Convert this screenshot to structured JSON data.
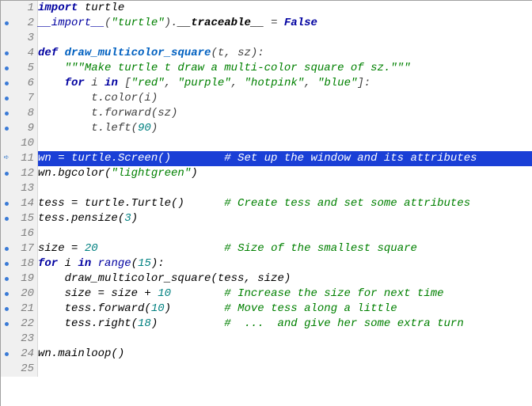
{
  "editor": {
    "current_line": 11,
    "lines": [
      {
        "n": 1,
        "marker": "",
        "tokens": [
          {
            "t": "kw",
            "v": "import"
          },
          {
            "t": "op",
            "v": " "
          },
          {
            "t": "attr",
            "v": "turtle"
          }
        ]
      },
      {
        "n": 2,
        "marker": "bp",
        "tokens": [
          {
            "t": "builtin",
            "v": "__import__"
          },
          {
            "t": "op",
            "v": "("
          },
          {
            "t": "str",
            "v": "\"turtle\""
          },
          {
            "t": "op",
            "v": ")."
          },
          {
            "t": "strongattr",
            "v": "__traceable__"
          },
          {
            "t": "op",
            "v": " = "
          },
          {
            "t": "bool",
            "v": "False"
          }
        ]
      },
      {
        "n": 3,
        "marker": "",
        "tokens": []
      },
      {
        "n": 4,
        "marker": "bp",
        "tokens": [
          {
            "t": "kw",
            "v": "def"
          },
          {
            "t": "op",
            "v": " "
          },
          {
            "t": "fn",
            "v": "draw_multicolor_square"
          },
          {
            "t": "op",
            "v": "(t, sz):"
          }
        ]
      },
      {
        "n": 5,
        "marker": "bp",
        "tokens": [
          {
            "t": "op",
            "v": "    "
          },
          {
            "t": "str",
            "v": "\"\"\"Make turtle t draw a multi-color square of sz.\"\"\""
          }
        ]
      },
      {
        "n": 6,
        "marker": "bp",
        "tokens": [
          {
            "t": "op",
            "v": "    "
          },
          {
            "t": "kw",
            "v": "for"
          },
          {
            "t": "op",
            "v": " i "
          },
          {
            "t": "kw",
            "v": "in"
          },
          {
            "t": "op",
            "v": " ["
          },
          {
            "t": "str",
            "v": "\"red\""
          },
          {
            "t": "op",
            "v": ", "
          },
          {
            "t": "str",
            "v": "\"purple\""
          },
          {
            "t": "op",
            "v": ", "
          },
          {
            "t": "str",
            "v": "\"hotpink\""
          },
          {
            "t": "op",
            "v": ", "
          },
          {
            "t": "str",
            "v": "\"blue\""
          },
          {
            "t": "op",
            "v": "]:"
          }
        ]
      },
      {
        "n": 7,
        "marker": "bp",
        "tokens": [
          {
            "t": "op",
            "v": "        t.color(i)"
          }
        ]
      },
      {
        "n": 8,
        "marker": "bp",
        "tokens": [
          {
            "t": "op",
            "v": "        t.forward(sz)"
          }
        ]
      },
      {
        "n": 9,
        "marker": "bp",
        "tokens": [
          {
            "t": "op",
            "v": "        t.left("
          },
          {
            "t": "num",
            "v": "90"
          },
          {
            "t": "op",
            "v": ")"
          }
        ]
      },
      {
        "n": 10,
        "marker": "",
        "tokens": []
      },
      {
        "n": 11,
        "marker": "arrow",
        "tokens": [
          {
            "t": "attr",
            "v": "wn = turtle.Screen()        "
          },
          {
            "t": "cmt",
            "v": "# Set up the window and its attributes"
          }
        ]
      },
      {
        "n": 12,
        "marker": "bp",
        "tokens": [
          {
            "t": "attr",
            "v": "wn.bgcolor("
          },
          {
            "t": "str",
            "v": "\"lightgreen\""
          },
          {
            "t": "attr",
            "v": ")"
          }
        ]
      },
      {
        "n": 13,
        "marker": "",
        "tokens": []
      },
      {
        "n": 14,
        "marker": "bp",
        "tokens": [
          {
            "t": "attr",
            "v": "tess = turtle.Turtle()      "
          },
          {
            "t": "cmt",
            "v": "# Create tess and set some attributes"
          }
        ]
      },
      {
        "n": 15,
        "marker": "bp",
        "tokens": [
          {
            "t": "attr",
            "v": "tess.pensize("
          },
          {
            "t": "num",
            "v": "3"
          },
          {
            "t": "attr",
            "v": ")"
          }
        ]
      },
      {
        "n": 16,
        "marker": "",
        "tokens": []
      },
      {
        "n": 17,
        "marker": "bp",
        "tokens": [
          {
            "t": "attr",
            "v": "size = "
          },
          {
            "t": "num",
            "v": "20"
          },
          {
            "t": "attr",
            "v": "                   "
          },
          {
            "t": "cmt",
            "v": "# Size of the smallest square"
          }
        ]
      },
      {
        "n": 18,
        "marker": "bp",
        "tokens": [
          {
            "t": "kw",
            "v": "for"
          },
          {
            "t": "attr",
            "v": " i "
          },
          {
            "t": "kw",
            "v": "in"
          },
          {
            "t": "attr",
            "v": " "
          },
          {
            "t": "builtin",
            "v": "range"
          },
          {
            "t": "attr",
            "v": "("
          },
          {
            "t": "num",
            "v": "15"
          },
          {
            "t": "attr",
            "v": "):"
          }
        ]
      },
      {
        "n": 19,
        "marker": "bp",
        "tokens": [
          {
            "t": "attr",
            "v": "    draw_multicolor_square(tess, size)"
          }
        ]
      },
      {
        "n": 20,
        "marker": "bp",
        "tokens": [
          {
            "t": "attr",
            "v": "    size = size + "
          },
          {
            "t": "num",
            "v": "10"
          },
          {
            "t": "attr",
            "v": "        "
          },
          {
            "t": "cmt",
            "v": "# Increase the size for next time"
          }
        ]
      },
      {
        "n": 21,
        "marker": "bp",
        "tokens": [
          {
            "t": "attr",
            "v": "    tess.forward("
          },
          {
            "t": "num",
            "v": "10"
          },
          {
            "t": "attr",
            "v": ")        "
          },
          {
            "t": "cmt",
            "v": "# Move tess along a little"
          }
        ]
      },
      {
        "n": 22,
        "marker": "bp",
        "tokens": [
          {
            "t": "attr",
            "v": "    tess.right("
          },
          {
            "t": "num",
            "v": "18"
          },
          {
            "t": "attr",
            "v": ")          "
          },
          {
            "t": "cmt",
            "v": "#  ...  and give her some extra turn"
          }
        ]
      },
      {
        "n": 23,
        "marker": "",
        "tokens": []
      },
      {
        "n": 24,
        "marker": "bp",
        "tokens": [
          {
            "t": "attr",
            "v": "wn.mainloop()"
          }
        ]
      },
      {
        "n": 25,
        "marker": "",
        "tokens": []
      }
    ]
  }
}
